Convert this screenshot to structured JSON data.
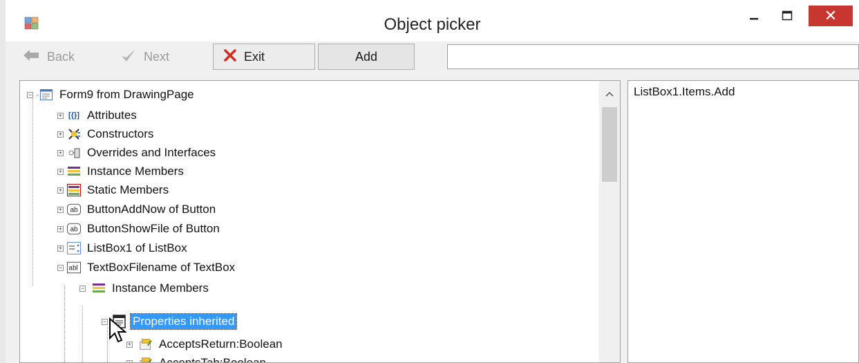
{
  "window": {
    "title": "Object picker",
    "close_glyph": "✕"
  },
  "toolbar": {
    "back_label": "Back",
    "next_label": "Next",
    "exit_label": "Exit",
    "add_label": "Add",
    "command_value": ""
  },
  "tree": {
    "root_label": "Form9 from DrawingPage",
    "items": [
      {
        "label": "Attributes",
        "icon": "attributes-icon"
      },
      {
        "label": "Constructors",
        "icon": "constructors-icon"
      },
      {
        "label": "Overrides and Interfaces",
        "icon": "interfaces-icon"
      },
      {
        "label": "Instance Members",
        "icon": "instance-members-icon"
      },
      {
        "label": "Static Members",
        "icon": "static-members-icon"
      },
      {
        "label": "ButtonAddNow of Button",
        "icon": "button-control-icon"
      },
      {
        "label": "ButtonShowFile of Button",
        "icon": "button-control-icon"
      },
      {
        "label": "ListBox1 of ListBox",
        "icon": "listbox-control-icon"
      },
      {
        "label": "TextBoxFilename of TextBox",
        "icon": "textbox-control-icon"
      },
      {
        "label": "Instance Members",
        "icon": "instance-members-icon"
      },
      {
        "label": "Properties inherited",
        "icon": "properties-icon"
      },
      {
        "label": "AcceptsReturn:Boolean",
        "icon": "property-icon"
      },
      {
        "label": "AcceptsTab:Boolean",
        "icon": "property-icon"
      }
    ]
  },
  "right_panel": {
    "text": "ListBox1.Items.Add"
  },
  "colors": {
    "selection": "#3399ff",
    "close_button": "#c7372f"
  }
}
